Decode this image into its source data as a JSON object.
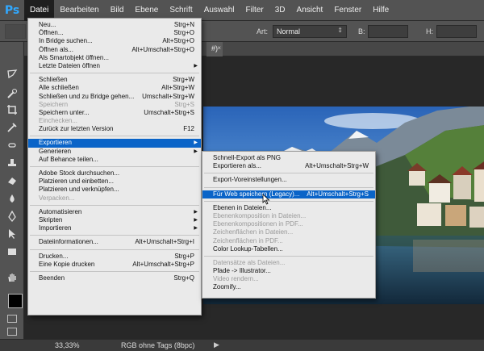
{
  "menubar": {
    "logo": "Ps",
    "items": [
      "Datei",
      "Bearbeiten",
      "Bild",
      "Ebene",
      "Schrift",
      "Auswahl",
      "Filter",
      "3D",
      "Ansicht",
      "Fenster",
      "Hilfe"
    ]
  },
  "optionsbar": {
    "art_label": "Art:",
    "mode_value": "Normal",
    "b_label": "B:",
    "h_label": "H:"
  },
  "tab": {
    "label": "#)",
    "close": "×"
  },
  "status": {
    "zoom": "33,33%",
    "info": "RGB ohne Tags (8bpc)"
  },
  "datei_menu": {
    "items": [
      {
        "label": "Neu...",
        "shortcut": "Strg+N"
      },
      {
        "label": "Öffnen...",
        "shortcut": "Strg+O"
      },
      {
        "label": "In Bridge suchen...",
        "shortcut": "Alt+Strg+O"
      },
      {
        "label": "Öffnen als...",
        "shortcut": "Alt+Umschalt+Strg+O"
      },
      {
        "label": "Als Smartobjekt öffnen...",
        "shortcut": ""
      },
      {
        "label": "Letzte Dateien öffnen",
        "shortcut": ""
      },
      {
        "label": "Schließen",
        "shortcut": "Strg+W"
      },
      {
        "label": "Alle schließen",
        "shortcut": "Alt+Strg+W"
      },
      {
        "label": "Schließen und zu Bridge gehen...",
        "shortcut": "Umschalt+Strg+W"
      },
      {
        "label": "Speichern",
        "shortcut": "Strg+S"
      },
      {
        "label": "Speichern unter...",
        "shortcut": "Umschalt+Strg+S"
      },
      {
        "label": "Einchecken...",
        "shortcut": ""
      },
      {
        "label": "Zurück zur letzten Version",
        "shortcut": "F12"
      },
      {
        "label": "Exportieren",
        "shortcut": ""
      },
      {
        "label": "Generieren",
        "shortcut": ""
      },
      {
        "label": "Auf Behance teilen...",
        "shortcut": ""
      },
      {
        "label": "Adobe Stock durchsuchen...",
        "shortcut": ""
      },
      {
        "label": "Platzieren und einbetten...",
        "shortcut": ""
      },
      {
        "label": "Platzieren und verknüpfen...",
        "shortcut": ""
      },
      {
        "label": "Verpacken...",
        "shortcut": ""
      },
      {
        "label": "Automatisieren",
        "shortcut": ""
      },
      {
        "label": "Skripten",
        "shortcut": ""
      },
      {
        "label": "Importieren",
        "shortcut": ""
      },
      {
        "label": "Dateiinformationen...",
        "shortcut": "Alt+Umschalt+Strg+I"
      },
      {
        "label": "Drucken...",
        "shortcut": "Strg+P"
      },
      {
        "label": "Eine Kopie drucken",
        "shortcut": "Alt+Umschalt+Strg+P"
      },
      {
        "label": "Beenden",
        "shortcut": "Strg+Q"
      }
    ]
  },
  "export_menu": {
    "items": [
      {
        "label": "Schnell-Export als PNG",
        "shortcut": ""
      },
      {
        "label": "Exportieren als...",
        "shortcut": "Alt+Umschalt+Strg+W"
      },
      {
        "label": "Export-Voreinstellungen...",
        "shortcut": ""
      },
      {
        "label": "Für Web speichern (Legacy)...",
        "shortcut": "Alt+Umschalt+Strg+S"
      },
      {
        "label": "Ebenen in Dateien...",
        "shortcut": ""
      },
      {
        "label": "Ebenenkomposition in Dateien...",
        "shortcut": ""
      },
      {
        "label": "Ebenenkompositionen in PDF...",
        "shortcut": ""
      },
      {
        "label": "Zeichenflächen in Dateien...",
        "shortcut": ""
      },
      {
        "label": "Zeichenflächen in PDF...",
        "shortcut": ""
      },
      {
        "label": "Color Lookup-Tabellen...",
        "shortcut": ""
      },
      {
        "label": "Datensätze als Dateien...",
        "shortcut": ""
      },
      {
        "label": "Pfade -> Illustrator...",
        "shortcut": ""
      },
      {
        "label": "Video rendern...",
        "shortcut": ""
      },
      {
        "label": "Zoomify...",
        "shortcut": ""
      }
    ]
  }
}
